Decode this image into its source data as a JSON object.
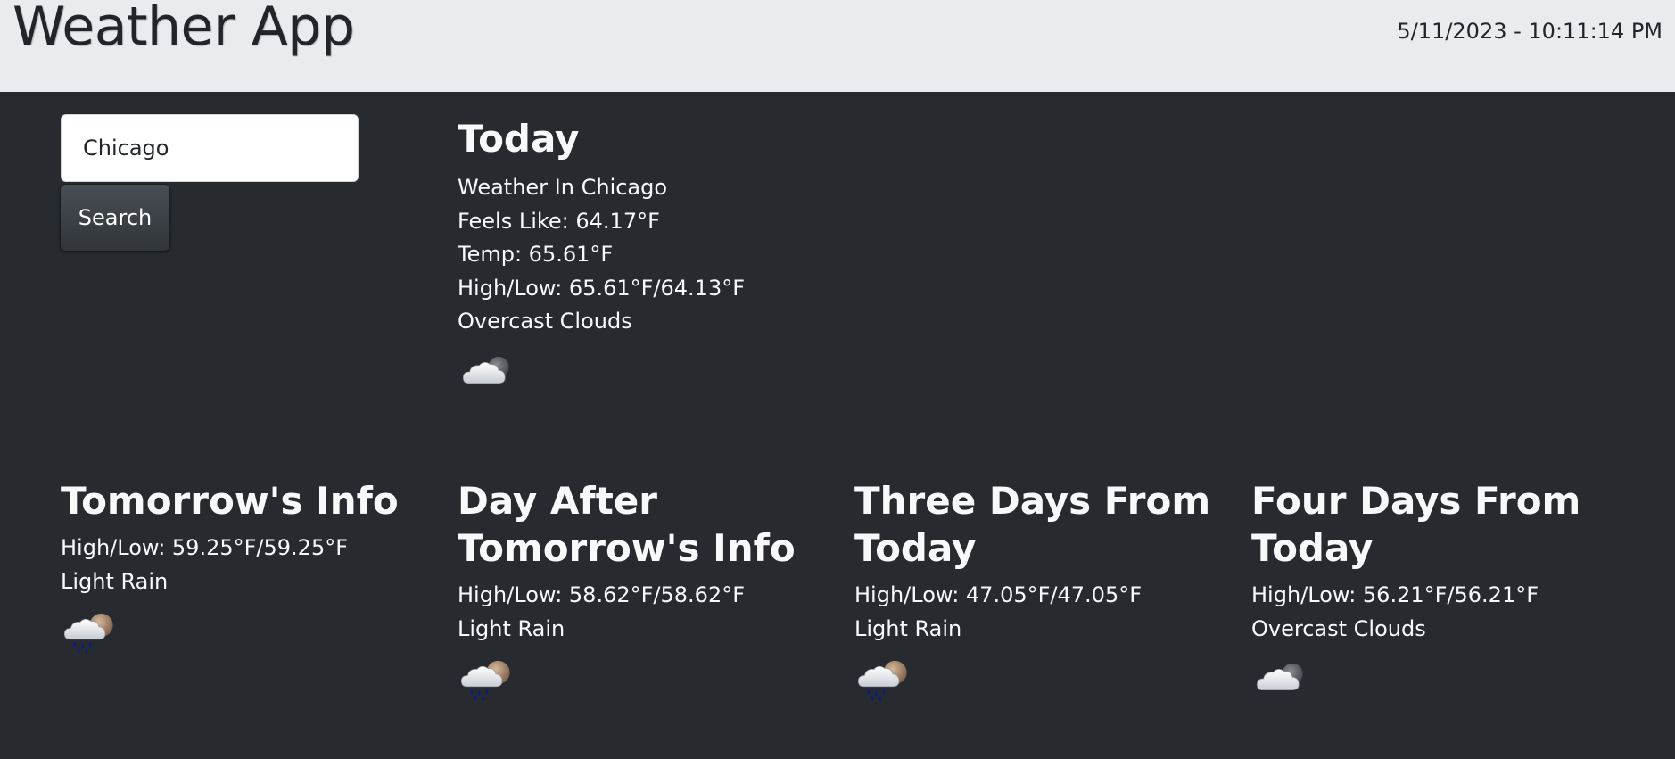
{
  "header": {
    "title": "Weather App",
    "datetime": "5/11/2023 - 10:11:14 PM"
  },
  "search": {
    "value": "Chicago",
    "button_label": "Search"
  },
  "today": {
    "title": "Today",
    "location": "Weather In Chicago",
    "feels_like": "Feels Like: 64.17°F",
    "temp": "Temp: 65.61°F",
    "high_low": "High/Low: 65.61°F/64.13°F",
    "condition": "Overcast Clouds",
    "icon": "overcast-clouds-icon"
  },
  "forecast": [
    {
      "title": "Tomorrow's Info",
      "high_low": "High/Low: 59.25°F/59.25°F",
      "condition": "Light Rain",
      "icon": "light-rain-icon"
    },
    {
      "title": "Day After Tomorrow's Info",
      "high_low": "High/Low: 58.62°F/58.62°F",
      "condition": "Light Rain",
      "icon": "light-rain-icon"
    },
    {
      "title": "Three Days From Today",
      "high_low": "High/Low: 47.05°F/47.05°F",
      "condition": "Light Rain",
      "icon": "light-rain-icon"
    },
    {
      "title": "Four Days From Today",
      "high_low": "High/Low: 56.21°F/56.21°F",
      "condition": "Overcast Clouds",
      "icon": "overcast-clouds-icon"
    }
  ],
  "colors": {
    "header_bg": "#e9ecef",
    "page_bg": "#272b30",
    "text": "#f8f9fa",
    "rain_drop": "#0a1a8c"
  }
}
